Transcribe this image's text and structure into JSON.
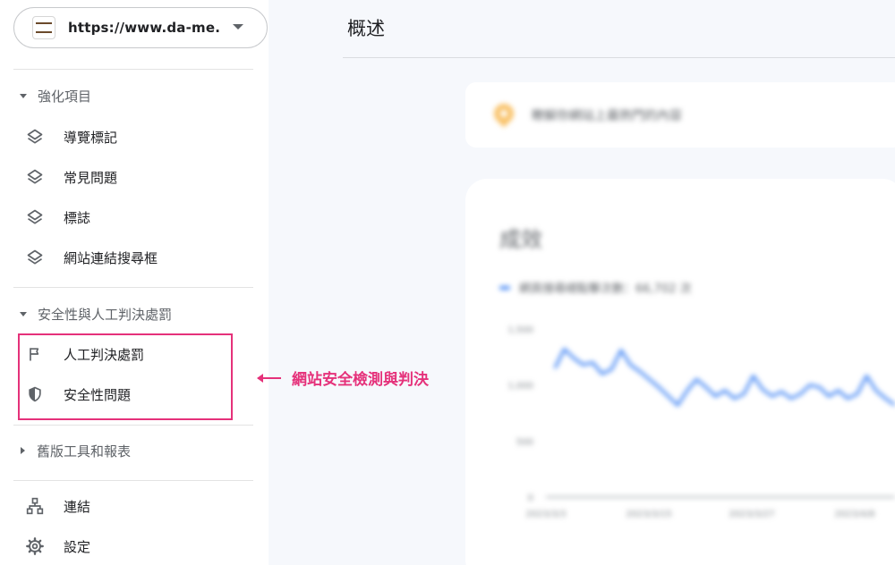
{
  "property": {
    "url": "https://www.da-me..."
  },
  "sidebar": {
    "sections": [
      {
        "label": "強化項目"
      },
      {
        "label": "安全性與人工判決處罰"
      },
      {
        "label": "舊版工具和報表"
      }
    ],
    "enhancements": [
      {
        "label": "導覽標記"
      },
      {
        "label": "常見問題"
      },
      {
        "label": "標誌"
      },
      {
        "label": "網站連結搜尋框"
      }
    ],
    "security": [
      {
        "label": "人工判決處罰"
      },
      {
        "label": "安全性問題"
      }
    ],
    "bottom": [
      {
        "label": "連結"
      },
      {
        "label": "設定"
      }
    ]
  },
  "annotation": {
    "text": "網站安全檢測與判決"
  },
  "main": {
    "title": "概述",
    "insight_text": "瞭解你網站上最熱門的內容",
    "performance": {
      "title": "成效",
      "legend": "網頁搜尋總點擊次數：66,702 次"
    }
  },
  "chart_data": {
    "type": "line",
    "yticks": [
      "1,500",
      "1,000",
      "500",
      "0"
    ],
    "ylim": [
      0,
      1500
    ],
    "xticks": [
      "2023/3/3",
      "2023/3/15",
      "2023/3/27",
      "2023/4/8"
    ],
    "series": [
      {
        "name": "網頁搜尋總點擊次數",
        "color": "#4285f4",
        "values": [
          1150,
          1320,
          1240,
          1180,
          1200,
          1100,
          1140,
          1310,
          1180,
          1120,
          1050,
          980,
          900,
          820,
          950,
          1050,
          980,
          900,
          950,
          880,
          920,
          1080,
          960,
          900,
          940,
          880,
          920,
          1000,
          980,
          900,
          950,
          880,
          920,
          1080,
          950,
          880,
          820
        ]
      }
    ]
  },
  "colors": {
    "accent": "#e5317a",
    "series": "#4285f4",
    "icon": "#5f6368"
  }
}
